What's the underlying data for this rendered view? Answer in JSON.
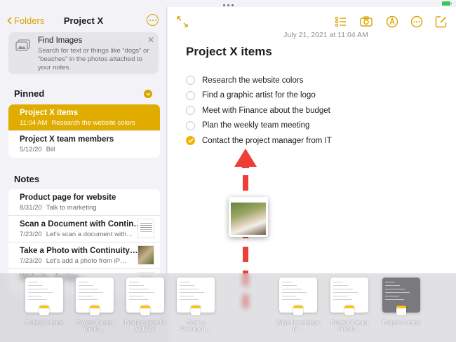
{
  "sidebar": {
    "back_label": "Folders",
    "title": "Project X",
    "find_images": {
      "title": "Find Images",
      "description": "Search for text or things like “dogs” or “beaches” in the photos attached to your notes."
    },
    "pinned_header": "Pinned",
    "pinned": [
      {
        "title": "Project X items",
        "date": "11:04 AM",
        "preview": "Research the website colors",
        "selected": true
      },
      {
        "title": "Project X team members",
        "date": "5/12/20",
        "preview": "Bill",
        "selected": false
      }
    ],
    "notes_header": "Notes",
    "notes": [
      {
        "title": "Product page for website",
        "date": "8/31/20",
        "preview": "Talk to marketing",
        "thumb": ""
      },
      {
        "title": "Scan a Document with Contin…",
        "date": "7/23/20",
        "preview": "Let's scan a document with…",
        "thumb": "doc"
      },
      {
        "title": "Take a Photo with Continuity…",
        "date": "7/23/20",
        "preview": "Let's add a photo from iP…",
        "thumb": "photo"
      },
      {
        "title": "Website design…",
        "date": "",
        "preview": "",
        "thumb": "doc"
      }
    ]
  },
  "main": {
    "date": "July 21, 2021 at 11:04 AM",
    "title": "Project X items",
    "checklist": [
      {
        "text": "Research the website colors",
        "done": false
      },
      {
        "text": "Find a graphic artist for the logo",
        "done": false
      },
      {
        "text": "Meet with Finance about the budget",
        "done": false
      },
      {
        "text": "Plan the weekly team meeting",
        "done": false
      },
      {
        "text": "Contact the project manager from IT",
        "done": true
      }
    ],
    "toolbar_icons": [
      "expand-icon",
      "checklist-icon",
      "camera-icon",
      "markup-icon",
      "more-icon",
      "compose-icon"
    ]
  },
  "shelf": {
    "windows": [
      {
        "label": "Project X items"
      },
      {
        "label": "Project X team memb…"
      },
      {
        "label": "Product page for website"
      },
      {
        "label": "Scan a Documen…"
      },
      {
        "label": "Website redesign pr…"
      },
      {
        "label": "Project X team memb…"
      },
      {
        "label": "Project X items"
      }
    ]
  },
  "colors": {
    "accent": "#e0ac00",
    "arrow": "#ef3e36"
  }
}
